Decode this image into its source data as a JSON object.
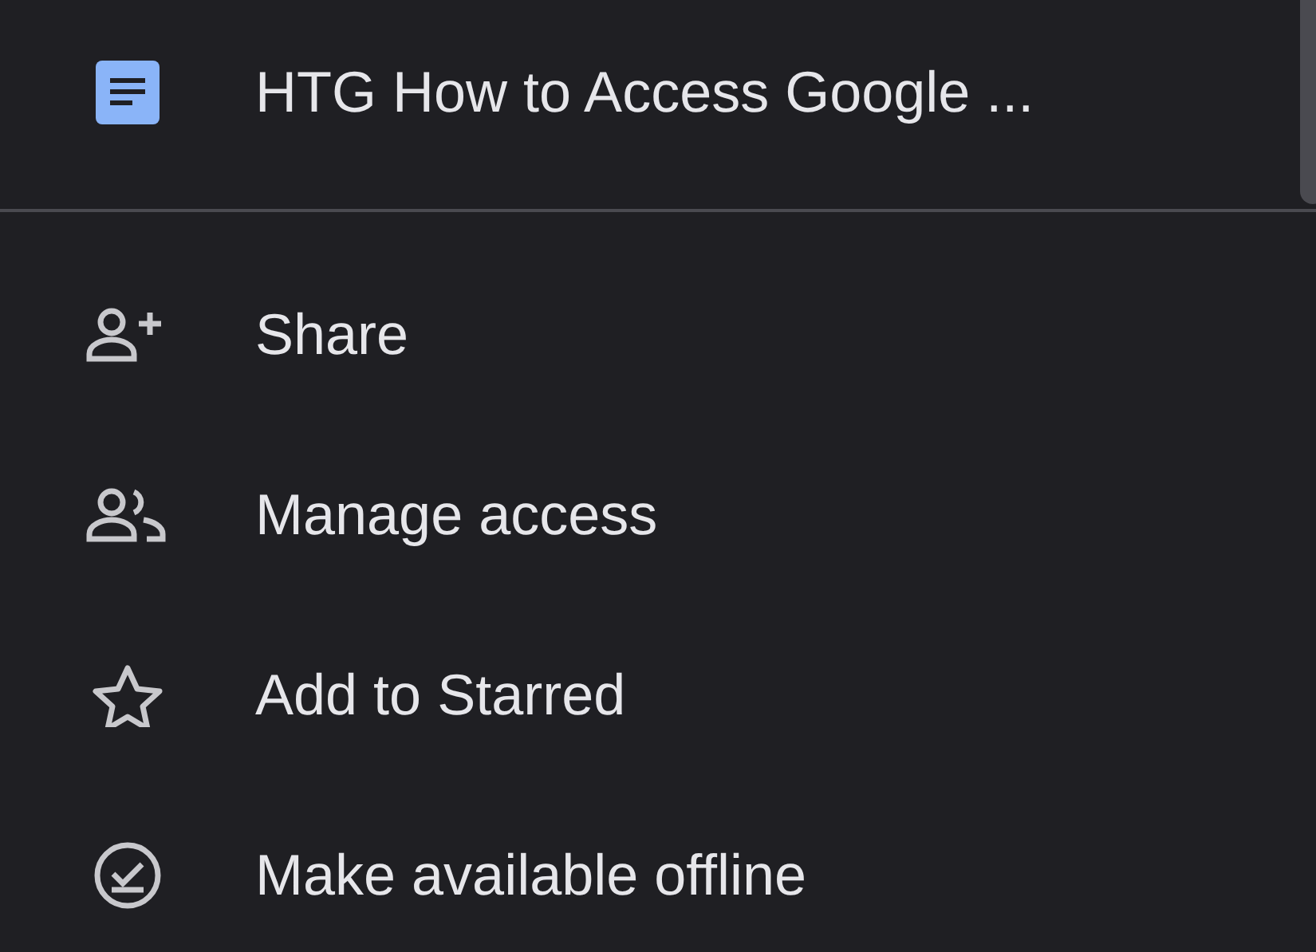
{
  "header": {
    "title": "HTG How to Access Google ..."
  },
  "menu": {
    "items": [
      {
        "label": "Share"
      },
      {
        "label": "Manage access"
      },
      {
        "label": "Add to Starred"
      },
      {
        "label": "Make available offline"
      }
    ]
  }
}
